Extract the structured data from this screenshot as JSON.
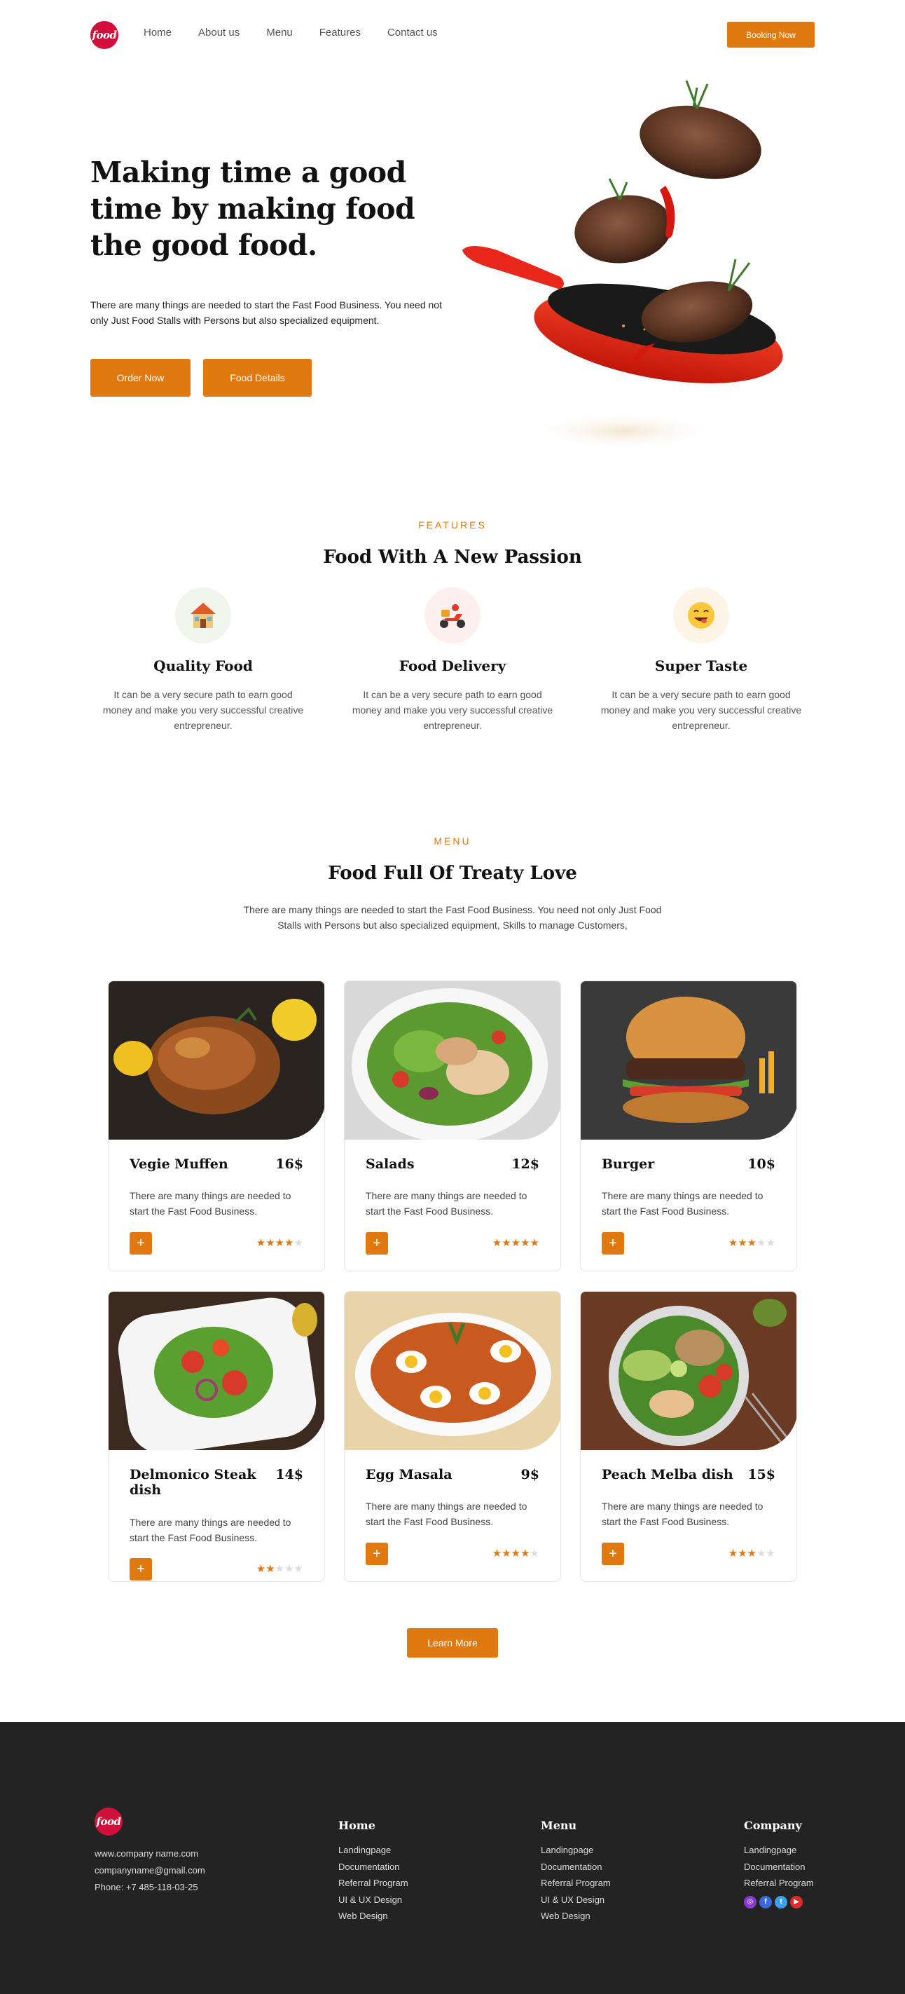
{
  "brand": {
    "logo_text": "food"
  },
  "nav": {
    "links": [
      "Home",
      "About us",
      "Menu",
      "Features",
      "Contact us"
    ],
    "cta": "Booking Now"
  },
  "hero": {
    "title": "Making time a good time by making food the good food.",
    "text": "There are many things are needed to start the Fast Food Business. You need not only Just Food Stalls with Persons but also specialized equipment.",
    "order_button": "Order Now",
    "details_button": "Food Details"
  },
  "features": {
    "eyebrow": "FEATURES",
    "title": "Food With A New Passion",
    "items": [
      {
        "title": "Quality Food",
        "text": "It can be a very secure path to earn good money and make you very successful creative entrepreneur.",
        "icon": "house-icon"
      },
      {
        "title": "Food Delivery",
        "text": "It can be a very secure path to earn good money and make you very successful creative entrepreneur.",
        "icon": "scooter-icon"
      },
      {
        "title": "Super Taste",
        "text": "It can be a very secure path to earn good money and make you very successful creative entrepreneur.",
        "icon": "yum-face-icon"
      }
    ]
  },
  "menu": {
    "eyebrow": "MENU",
    "title": "Food Full Of Treaty Love",
    "subtitle": "There are many things are needed to start the Fast Food Business. You need not only Just Food Stalls with Persons but also specialized equipment, Skills to manage Customers,",
    "items": [
      {
        "name": "Vegie Muffen",
        "price": "16$",
        "desc": "There are many things are needed to start the Fast Food Business.",
        "rating": 4,
        "add": "+"
      },
      {
        "name": "Salads",
        "price": "12$",
        "desc": "There are many things are needed to start the Fast Food Business.",
        "rating": 5,
        "add": "+"
      },
      {
        "name": "Burger",
        "price": "10$",
        "desc": "There are many things are needed to start the Fast Food Business.",
        "rating": 3,
        "add": "+"
      },
      {
        "name": "Delmonico Steak dish",
        "price": "14$",
        "desc": "There are many things are needed to start the Fast Food Business.",
        "rating": 2,
        "add": "+"
      },
      {
        "name": "Egg Masala",
        "price": "9$",
        "desc": "There are many things are needed to start the Fast Food Business.",
        "rating": 4,
        "add": "+"
      },
      {
        "name": "Peach Melba dish",
        "price": "15$",
        "desc": "There are many things are needed to start the Fast Food Business.",
        "rating": 3,
        "add": "+"
      }
    ],
    "learn_more": "Learn More"
  },
  "footer": {
    "contact": [
      "www.company name.com",
      "companyname@gmail.com",
      "Phone: +7 485-118-03-25"
    ],
    "columns": [
      {
        "title": "Home",
        "links": [
          "Landingpage",
          "Documentation",
          "Referral Program",
          "UI & UX Design",
          "Web Design"
        ]
      },
      {
        "title": "Menu",
        "links": [
          "Landingpage",
          "Documentation",
          "Referral Program",
          "UI & UX Design",
          "Web Design"
        ]
      },
      {
        "title": "Company",
        "links": [
          "Landingpage",
          "Documentation",
          "Referral Program"
        ]
      }
    ],
    "socials": [
      "instagram-icon",
      "facebook-icon",
      "twitter-icon",
      "youtube-icon"
    ]
  },
  "colors": {
    "accent": "#e07a10",
    "logo": "#d0103a",
    "footer_bg": "#232323"
  }
}
